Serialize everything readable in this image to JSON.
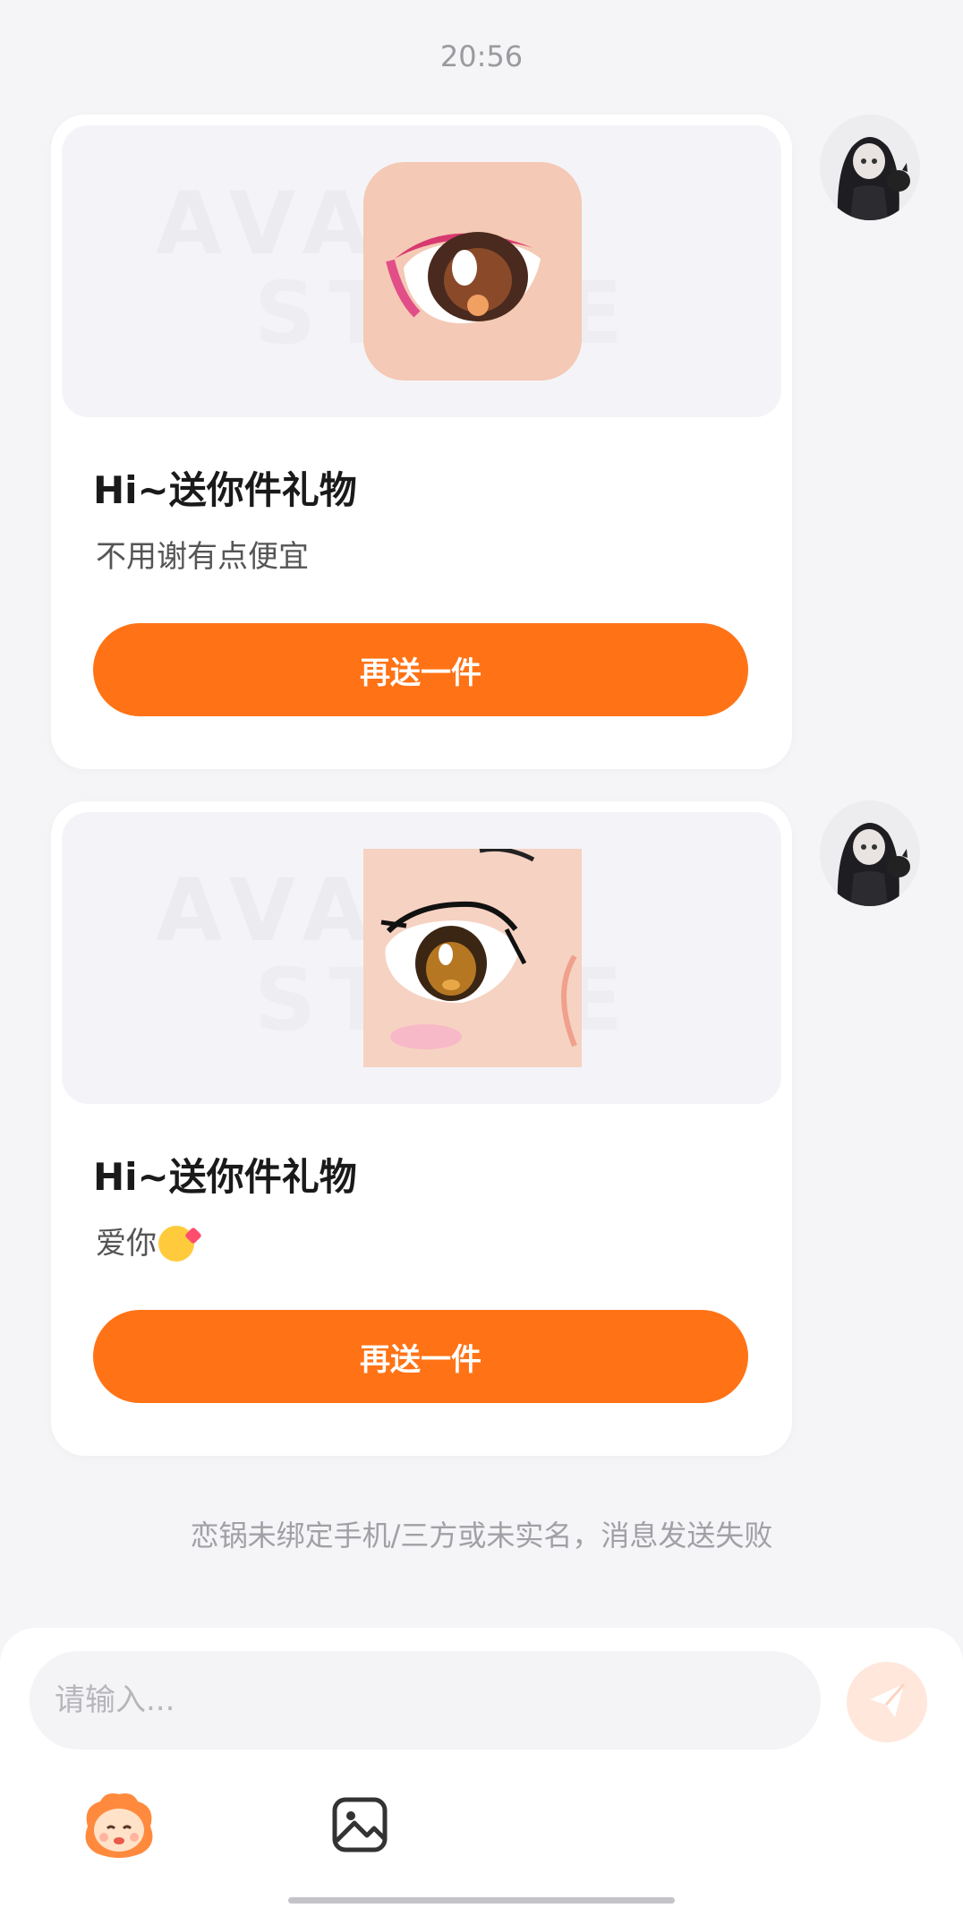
{
  "timestamp": "20:56",
  "messages": [
    {
      "title": "Hi~送你件礼物",
      "subtitle": "不用谢有点便宜",
      "button": "再送一件",
      "watermark_line1": "AVATAR",
      "watermark_line2": "STORE"
    },
    {
      "title": "Hi~送你件礼物",
      "subtitle": "爱你",
      "button": "再送一件",
      "watermark_line1": "AVATAR",
      "watermark_line2": "STORE"
    }
  ],
  "notice": "恋锅未绑定手机/三方或未实名，消息发送失败",
  "input": {
    "placeholder": "请输入..."
  },
  "colors": {
    "accent": "#ff7316",
    "send_disabled": "#ffe7dc",
    "background": "#f5f5f7"
  },
  "icons": {
    "send": "paper-plane-icon",
    "mascot": "mascot-face-icon",
    "image": "image-icon"
  }
}
